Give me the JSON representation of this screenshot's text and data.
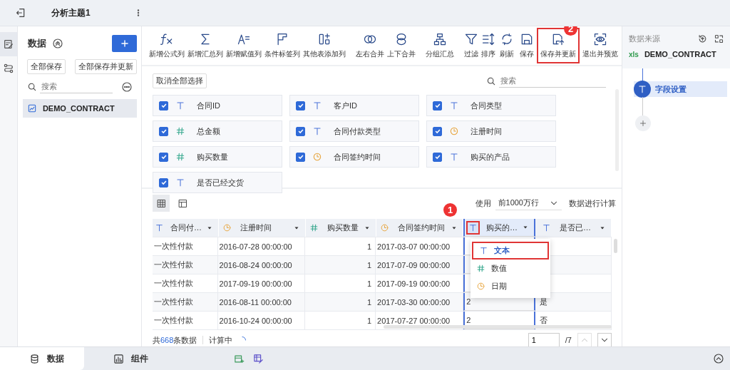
{
  "top_bar": {
    "tab_title": "分析主题1"
  },
  "left_rail": {
    "items": [
      {
        "selected": true
      },
      {
        "selected": false
      }
    ]
  },
  "left_panel": {
    "title": "数据",
    "buttons": [
      "全部保存",
      "全部保存并更新"
    ],
    "search": {
      "placeholder": "搜索"
    },
    "items": [
      {
        "label": "DEMO_CONTRACT",
        "selected": true
      }
    ]
  },
  "toolbar": {
    "groups": [
      {
        "items": [
          "新增公式列",
          "新增汇总列",
          "新增赋值列",
          "条件标签列",
          "其他表添加列"
        ]
      },
      {
        "items": [
          "左右合并",
          "上下合并"
        ]
      },
      {
        "items": [
          "分组汇总"
        ]
      },
      {
        "items": [
          "过滤",
          "排序"
        ]
      }
    ],
    "actions": [
      {
        "label": "刷新",
        "highlighted": false
      },
      {
        "label": "保存",
        "highlighted": false
      },
      {
        "label": "保存并更新",
        "highlighted": true,
        "callout": "2"
      },
      {
        "label": "退出并预览",
        "highlighted": false
      }
    ]
  },
  "fields": {
    "deselect_button": "取消全部选择",
    "search": {
      "placeholder": "搜索"
    },
    "items": [
      {
        "label": "合同ID",
        "kind": "text",
        "checked": true
      },
      {
        "label": "客户ID",
        "kind": "text",
        "checked": true
      },
      {
        "label": "合同类型",
        "kind": "text",
        "checked": true
      },
      {
        "label": "总金额",
        "kind": "number",
        "checked": true
      },
      {
        "label": "合同付款类型",
        "kind": "text",
        "checked": true
      },
      {
        "label": "注册时间",
        "kind": "date",
        "checked": true
      },
      {
        "label": "购买数量",
        "kind": "number",
        "checked": true
      },
      {
        "label": "合同签约时间",
        "kind": "date",
        "checked": true
      },
      {
        "label": "购买的产品",
        "kind": "text",
        "checked": true
      },
      {
        "label": "是否已经交货",
        "kind": "text",
        "checked": true
      }
    ]
  },
  "preview": {
    "views": [
      {
        "selected": true
      },
      {
        "selected": false
      }
    ],
    "row_limit": {
      "prefix": "使用",
      "value": "前1000万行",
      "suffix": "数据进行计算"
    },
    "table": {
      "columns": [
        {
          "label": "合同付…",
          "kind": "text",
          "selected": false,
          "highlighted": false
        },
        {
          "label": "注册时间",
          "kind": "date",
          "selected": false,
          "highlighted": false
        },
        {
          "label": "购买数量",
          "kind": "number",
          "selected": false,
          "highlighted": false
        },
        {
          "label": "合同签约时间",
          "kind": "date",
          "selected": false,
          "highlighted": false
        },
        {
          "label": "购买的…",
          "kind": "text",
          "selected": true,
          "highlighted": true,
          "callout": "1"
        },
        {
          "label": "是否已…",
          "kind": "text",
          "selected": false,
          "highlighted": false
        }
      ],
      "rows": [
        [
          "一次性付款",
          "2016-07-28 00:00:00",
          "1",
          "2017-03-07 00:00:00",
          null,
          null
        ],
        [
          "一次性付款",
          "2016-08-24 00:00:00",
          "1",
          "2017-07-09 00:00:00",
          null,
          null
        ],
        [
          "一次性付款",
          "2017-09-19 00:00:00",
          "1",
          "2017-09-19 00:00:00",
          null,
          null
        ],
        [
          "一次性付款",
          "2016-08-11 00:00:00",
          "1",
          "2017-03-30 00:00:00",
          "2",
          "是"
        ],
        [
          "一次性付款",
          "2016-10-24 00:00:00",
          "1",
          "2017-07-27 00:00:00",
          "2",
          "否"
        ]
      ]
    },
    "type_menu": {
      "items": [
        {
          "label": "文本",
          "kind": "text",
          "selected": true,
          "highlighted": true
        },
        {
          "label": "数值",
          "kind": "number",
          "selected": false,
          "highlighted": false
        },
        {
          "label": "日期",
          "kind": "date",
          "selected": false,
          "highlighted": false
        }
      ]
    },
    "footer": {
      "total_prefix": "共",
      "total_count": "668",
      "total_suffix": "条数据",
      "status": "计算中"
    },
    "pager": {
      "page": "1",
      "total": "/7",
      "prev_disabled": true,
      "next_disabled": false
    }
  },
  "right_panel": {
    "title": "数据来源",
    "file_badge": "xls",
    "source": "DEMO_CONTRACT",
    "steps": [
      {
        "label": "字段设置",
        "selected": true
      }
    ]
  },
  "bottom_bar": {
    "tabs": [
      {
        "label": "数据",
        "selected": true
      },
      {
        "label": "组件",
        "selected": false
      }
    ]
  }
}
